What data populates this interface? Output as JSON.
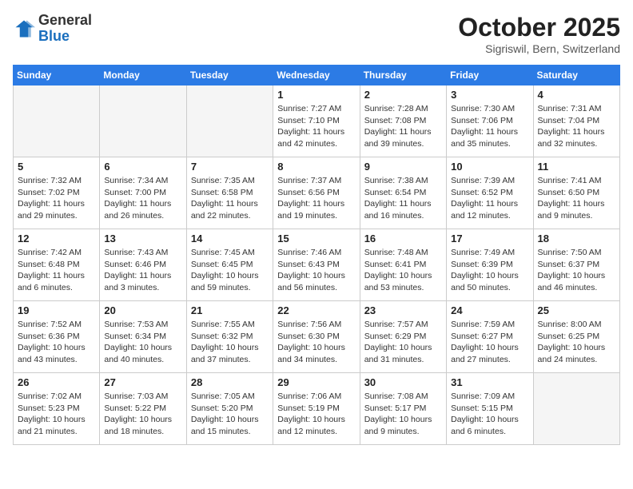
{
  "header": {
    "logo_line1": "General",
    "logo_line2": "Blue",
    "month": "October 2025",
    "location": "Sigriswil, Bern, Switzerland"
  },
  "weekdays": [
    "Sunday",
    "Monday",
    "Tuesday",
    "Wednesday",
    "Thursday",
    "Friday",
    "Saturday"
  ],
  "weeks": [
    [
      {
        "day": "",
        "info": ""
      },
      {
        "day": "",
        "info": ""
      },
      {
        "day": "",
        "info": ""
      },
      {
        "day": "1",
        "info": "Sunrise: 7:27 AM\nSunset: 7:10 PM\nDaylight: 11 hours\nand 42 minutes."
      },
      {
        "day": "2",
        "info": "Sunrise: 7:28 AM\nSunset: 7:08 PM\nDaylight: 11 hours\nand 39 minutes."
      },
      {
        "day": "3",
        "info": "Sunrise: 7:30 AM\nSunset: 7:06 PM\nDaylight: 11 hours\nand 35 minutes."
      },
      {
        "day": "4",
        "info": "Sunrise: 7:31 AM\nSunset: 7:04 PM\nDaylight: 11 hours\nand 32 minutes."
      }
    ],
    [
      {
        "day": "5",
        "info": "Sunrise: 7:32 AM\nSunset: 7:02 PM\nDaylight: 11 hours\nand 29 minutes."
      },
      {
        "day": "6",
        "info": "Sunrise: 7:34 AM\nSunset: 7:00 PM\nDaylight: 11 hours\nand 26 minutes."
      },
      {
        "day": "7",
        "info": "Sunrise: 7:35 AM\nSunset: 6:58 PM\nDaylight: 11 hours\nand 22 minutes."
      },
      {
        "day": "8",
        "info": "Sunrise: 7:37 AM\nSunset: 6:56 PM\nDaylight: 11 hours\nand 19 minutes."
      },
      {
        "day": "9",
        "info": "Sunrise: 7:38 AM\nSunset: 6:54 PM\nDaylight: 11 hours\nand 16 minutes."
      },
      {
        "day": "10",
        "info": "Sunrise: 7:39 AM\nSunset: 6:52 PM\nDaylight: 11 hours\nand 12 minutes."
      },
      {
        "day": "11",
        "info": "Sunrise: 7:41 AM\nSunset: 6:50 PM\nDaylight: 11 hours\nand 9 minutes."
      }
    ],
    [
      {
        "day": "12",
        "info": "Sunrise: 7:42 AM\nSunset: 6:48 PM\nDaylight: 11 hours\nand 6 minutes."
      },
      {
        "day": "13",
        "info": "Sunrise: 7:43 AM\nSunset: 6:46 PM\nDaylight: 11 hours\nand 3 minutes."
      },
      {
        "day": "14",
        "info": "Sunrise: 7:45 AM\nSunset: 6:45 PM\nDaylight: 10 hours\nand 59 minutes."
      },
      {
        "day": "15",
        "info": "Sunrise: 7:46 AM\nSunset: 6:43 PM\nDaylight: 10 hours\nand 56 minutes."
      },
      {
        "day": "16",
        "info": "Sunrise: 7:48 AM\nSunset: 6:41 PM\nDaylight: 10 hours\nand 53 minutes."
      },
      {
        "day": "17",
        "info": "Sunrise: 7:49 AM\nSunset: 6:39 PM\nDaylight: 10 hours\nand 50 minutes."
      },
      {
        "day": "18",
        "info": "Sunrise: 7:50 AM\nSunset: 6:37 PM\nDaylight: 10 hours\nand 46 minutes."
      }
    ],
    [
      {
        "day": "19",
        "info": "Sunrise: 7:52 AM\nSunset: 6:36 PM\nDaylight: 10 hours\nand 43 minutes."
      },
      {
        "day": "20",
        "info": "Sunrise: 7:53 AM\nSunset: 6:34 PM\nDaylight: 10 hours\nand 40 minutes."
      },
      {
        "day": "21",
        "info": "Sunrise: 7:55 AM\nSunset: 6:32 PM\nDaylight: 10 hours\nand 37 minutes."
      },
      {
        "day": "22",
        "info": "Sunrise: 7:56 AM\nSunset: 6:30 PM\nDaylight: 10 hours\nand 34 minutes."
      },
      {
        "day": "23",
        "info": "Sunrise: 7:57 AM\nSunset: 6:29 PM\nDaylight: 10 hours\nand 31 minutes."
      },
      {
        "day": "24",
        "info": "Sunrise: 7:59 AM\nSunset: 6:27 PM\nDaylight: 10 hours\nand 27 minutes."
      },
      {
        "day": "25",
        "info": "Sunrise: 8:00 AM\nSunset: 6:25 PM\nDaylight: 10 hours\nand 24 minutes."
      }
    ],
    [
      {
        "day": "26",
        "info": "Sunrise: 7:02 AM\nSunset: 5:23 PM\nDaylight: 10 hours\nand 21 minutes."
      },
      {
        "day": "27",
        "info": "Sunrise: 7:03 AM\nSunset: 5:22 PM\nDaylight: 10 hours\nand 18 minutes."
      },
      {
        "day": "28",
        "info": "Sunrise: 7:05 AM\nSunset: 5:20 PM\nDaylight: 10 hours\nand 15 minutes."
      },
      {
        "day": "29",
        "info": "Sunrise: 7:06 AM\nSunset: 5:19 PM\nDaylight: 10 hours\nand 12 minutes."
      },
      {
        "day": "30",
        "info": "Sunrise: 7:08 AM\nSunset: 5:17 PM\nDaylight: 10 hours\nand 9 minutes."
      },
      {
        "day": "31",
        "info": "Sunrise: 7:09 AM\nSunset: 5:15 PM\nDaylight: 10 hours\nand 6 minutes."
      },
      {
        "day": "",
        "info": ""
      }
    ]
  ]
}
